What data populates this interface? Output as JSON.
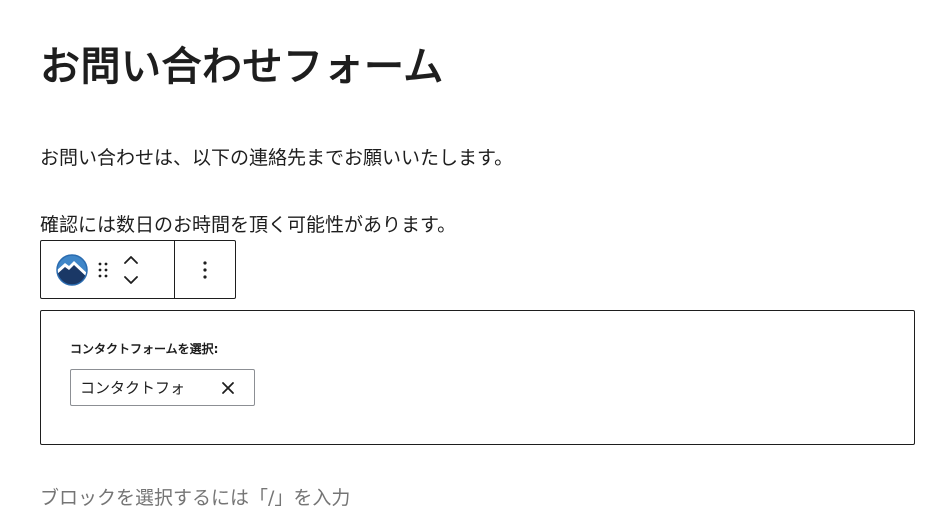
{
  "page": {
    "title": "お問い合わせフォーム",
    "paragraphs": [
      "お問い合わせは、以下の連絡先までお願いいたします。",
      "確認には数日のお時間を頂く可能性があります。"
    ]
  },
  "toolbar": {
    "block_icon": "mountain-logo-icon",
    "drag_icon": "drag-handle-icon",
    "move_up_icon": "chevron-up-icon",
    "move_down_icon": "chevron-down-icon",
    "options_icon": "more-vertical-icon"
  },
  "contact_form_block": {
    "select_label": "コンタクトフォームを選択:",
    "selected_token": "コンタクトフォ",
    "remove_icon": "close-icon"
  },
  "appender": {
    "placeholder": "ブロックを選択するには「/」を入力"
  },
  "colors": {
    "text": "#1e1e1e",
    "placeholder": "#757575",
    "logo_blue": "#2b6cb0",
    "logo_navy": "#1a3866"
  }
}
